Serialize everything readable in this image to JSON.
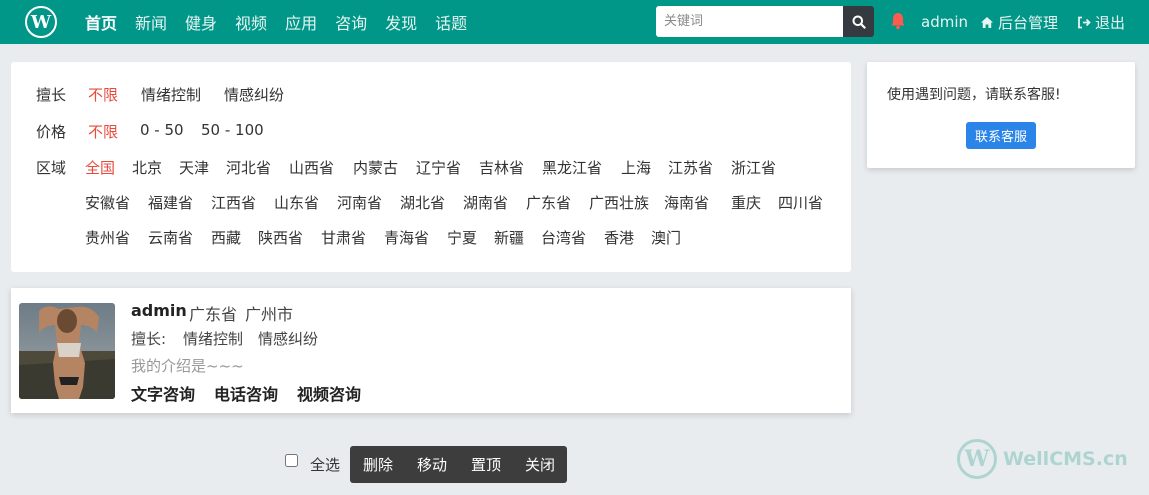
{
  "navbar": {
    "logo_letter": "W",
    "links": [
      "首页",
      "新闻",
      "健身",
      "视频",
      "应用",
      "咨询",
      "发现",
      "话题"
    ],
    "search_placeholder": "关键词",
    "user": "admin",
    "admin_label": "后台管理",
    "logout_label": "退出"
  },
  "filters": {
    "skill_label": "擅长",
    "skill_options": [
      "不限",
      "情绪控制",
      "情感纠纷"
    ],
    "price_label": "价格",
    "price_options": [
      "不限",
      "0 - 50",
      "50 - 100"
    ],
    "region_label": "区域",
    "region_row1": [
      "全国",
      "北京",
      "天津",
      "河北省",
      "山西省",
      "内蒙古",
      "辽宁省",
      "吉林省",
      "黑龙江省",
      "上海",
      "江苏省",
      "浙江省"
    ],
    "region_row2": [
      "安徽省",
      "福建省",
      "江西省",
      "山东省",
      "河南省",
      "湖北省",
      "湖南省",
      "广东省",
      "广西壮族",
      "海南省",
      "重庆",
      "四川省"
    ],
    "region_row3": [
      "贵州省",
      "云南省",
      "西藏",
      "陕西省",
      "甘肃省",
      "青海省",
      "宁夏",
      "新疆",
      "台湾省",
      "香港",
      "澳门"
    ]
  },
  "user_card": {
    "name": "admin",
    "province": "广东省",
    "city": "广州市",
    "skill_label": "擅长:",
    "skills": [
      "情绪控制",
      "情感纠纷"
    ],
    "intro": "我的介绍是~~~",
    "actions": [
      "文字咨询",
      "电话咨询",
      "视频咨询"
    ]
  },
  "sidebar": {
    "notice": "使用遇到问题，请联系客服!",
    "contact_button": "联系客服"
  },
  "bottom_bar": {
    "select_all": "全选",
    "buttons": [
      "删除",
      "移动",
      "置顶",
      "关闭"
    ]
  },
  "watermark": {
    "letter": "W",
    "text": "WellCMS.cn"
  },
  "colors": {
    "navbar": "#009688",
    "active_option": "#e84a3c",
    "contact_button": "#2b84e8",
    "action_bar": "#3d3d3d"
  }
}
